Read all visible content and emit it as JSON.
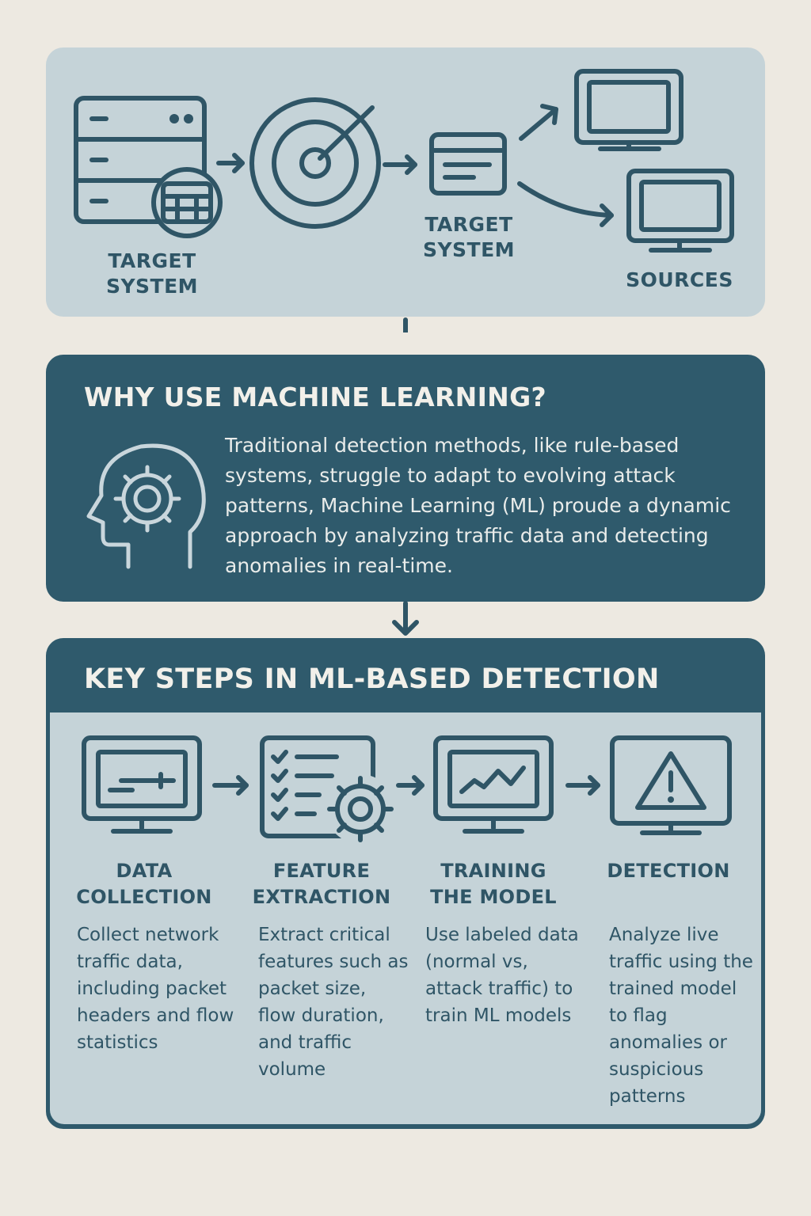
{
  "flow": {
    "labels": [
      "TARGET\nSYSTEM",
      "TARGET\nSYSTEM",
      "SOURCES"
    ],
    "icons": [
      "server-icon",
      "target-icon",
      "window-icon",
      "monitor-icon",
      "monitor-icon"
    ]
  },
  "why": {
    "title": "WHY USE MACHINE LEARNING?",
    "text": "Traditional detection methods, like rule-based systems, struggle to adapt to evolving attack patterns, Machine Learning (ML) proude a dynamic approach by analyzing traffic data and detecting anomalies in real-time.",
    "icon": "head-gear-icon"
  },
  "steps": {
    "title": "KEY STEPS IN ML-BASED DETECTION",
    "items": [
      {
        "title": "DATA\nCOLLECTION",
        "text": "Collect network traffic data, including packet headers and flow statistics",
        "icon": "monitor-data-icon"
      },
      {
        "title": "FEATURE\nEXTRACTION",
        "text": "Extract critical features such as packet size, flow duration, and traffic volume",
        "icon": "checklist-gear-icon"
      },
      {
        "title": "TRAINING\nTHE MODEL",
        "text": "Use labeled data (normal vs, attack traffic) to train ML models",
        "icon": "monitor-chart-icon"
      },
      {
        "title": "DETECTION",
        "text": "Analyze live traffic using the trained model to flag anomalies or suspicious patterns",
        "icon": "warning-monitor-icon"
      }
    ]
  },
  "colors": {
    "dark": "#2f5a6c",
    "light": "#c5d3d8",
    "background": "#ede9e1",
    "text_light": "#f2f0ea"
  }
}
